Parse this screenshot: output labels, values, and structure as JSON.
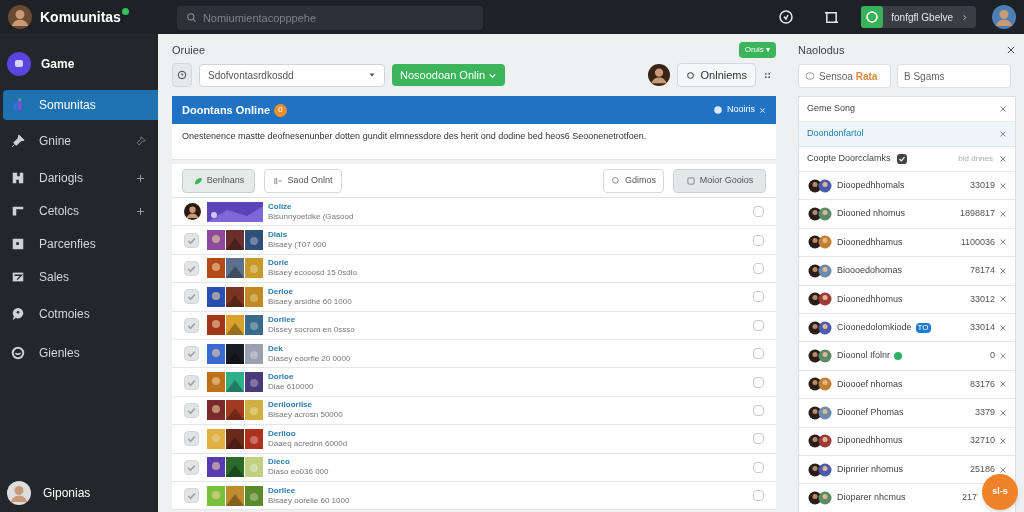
{
  "top_bar": {
    "brand": "Komuunitas",
    "search": {
      "placeholder": "Nomiumientacopppehe"
    },
    "action_button": "fonfgfl Gbelve"
  },
  "sidebar": {
    "header": "Game",
    "items": [
      {
        "label": "Somunitas",
        "selected": true
      },
      {
        "label": "Gnine",
        "selected": false
      },
      {
        "label": "Dariogis",
        "selected": false
      },
      {
        "label": "Cetolcs",
        "selected": false
      },
      {
        "label": "Parcenfies",
        "selected": false
      },
      {
        "label": "Sales",
        "selected": false
      },
      {
        "label": "Cotmoies",
        "selected": false
      },
      {
        "label": "Gienles",
        "selected": false
      }
    ],
    "user": "Giponias"
  },
  "main": {
    "title": "Oruiee",
    "badge": "Oruis ▾",
    "select": "Sdofvontasrdkosdd",
    "primary_button": "Nosoodoan Onlin",
    "side_button": "Onlniems",
    "banner": {
      "title": "Doontans Online",
      "count": "0",
      "action": "Nooiris"
    },
    "description": "Onestenence mastte deofnesenunber dotten gundit elmnessdore des herit ond dodine bed heos6 Seoonenetrotfoen.",
    "toolbar": [
      {
        "label": "Benlnans",
        "kind": "leaf"
      },
      {
        "label": "Saod Onlnt",
        "kind": "split"
      },
      {
        "label": "Gdimos",
        "kind": "search"
      },
      {
        "label": "Moior Gooios",
        "kind": "box"
      }
    ],
    "rows": [
      {
        "kind": "avatar",
        "title": "Colize",
        "subtitle": "Bisunnyoetdke (Gasood",
        "selected": false
      },
      {
        "kind": "check",
        "checked": true,
        "title": "Dlais",
        "subtitle": "Bisaey (T07 000",
        "selected": false
      },
      {
        "kind": "check",
        "checked": true,
        "title": "Dorie",
        "subtitle": "Bisaey ecooosd 15 0sdlo",
        "selected": false
      },
      {
        "kind": "check",
        "checked": true,
        "title": "Derloe",
        "subtitle": "Bisaey arsidhe 60 1000",
        "selected": false
      },
      {
        "kind": "check",
        "checked": true,
        "title": "Dorilee",
        "subtitle": "Dlssey socrom en 0ssso",
        "selected": false
      },
      {
        "kind": "check",
        "checked": true,
        "title": "Dek",
        "subtitle": "Diasey eoorfle 20 0000",
        "selected": false
      },
      {
        "kind": "check",
        "checked": true,
        "title": "Dorloe",
        "subtitle": "Diae 610000",
        "selected": false
      },
      {
        "kind": "check",
        "checked": true,
        "title": "Deriloorllse",
        "subtitle": "Bisaey acrosn 50000",
        "selected": false
      },
      {
        "kind": "check",
        "checked": true,
        "title": "Derlioo",
        "subtitle": "Daaeq acrednn 6000d",
        "selected": false
      },
      {
        "kind": "check",
        "checked": true,
        "title": "Dieco",
        "subtitle": "Diaso eo036 000",
        "selected": false
      },
      {
        "kind": "check",
        "checked": true,
        "title": "Dorllee",
        "subtitle": "Bisaey oorelie 60 1000",
        "selected": false
      }
    ]
  },
  "panel": {
    "title": "Naolodus",
    "field_a": {
      "value": "Sensoa **Rata**"
    },
    "field_b": {
      "placeholder": "B Sgams"
    },
    "items": [
      {
        "kind": "plain",
        "label": "Geme Song",
        "selected": false,
        "verified": false
      },
      {
        "kind": "plain",
        "label": "Doondonfartol",
        "selected": true,
        "verified": false
      },
      {
        "kind": "plain",
        "label": "Coopte Doorcclamks",
        "selected": false,
        "verified": true,
        "meta": "bld dnnes"
      },
      {
        "kind": "person",
        "label": "Dioopedhhomals",
        "count": "33019",
        "online": false
      },
      {
        "kind": "person",
        "label": "Diooned nhomus",
        "count": "1898817",
        "online": false
      },
      {
        "kind": "person",
        "label": "Dioonedhhamus",
        "count": "1100036",
        "online": false
      },
      {
        "kind": "person",
        "label": "Bioooedohomas",
        "count": "78174",
        "online": false
      },
      {
        "kind": "person",
        "label": "Dioonedhhomus",
        "count": "33012",
        "online": false
      },
      {
        "kind": "person",
        "label": "Cioonedolomkiode",
        "count": "33014",
        "online": false,
        "tag": "TO"
      },
      {
        "kind": "person",
        "label": "Dioonol Ifolnr",
        "count": "0",
        "online": true
      },
      {
        "kind": "person",
        "label": "Dioooef nhomas",
        "count": "83176",
        "online": false
      },
      {
        "kind": "person",
        "label": "Dioonef Phomas",
        "count": "3379",
        "online": false
      },
      {
        "kind": "person",
        "label": "Diponedhhomus",
        "count": "32710",
        "online": false
      },
      {
        "kind": "person",
        "label": "Dipnrier nhomus",
        "count": "25186",
        "online": false
      },
      {
        "kind": "person",
        "label": "Dioparer nhcmus",
        "count": "217",
        "online": false
      }
    ]
  },
  "fab": "sl-s"
}
